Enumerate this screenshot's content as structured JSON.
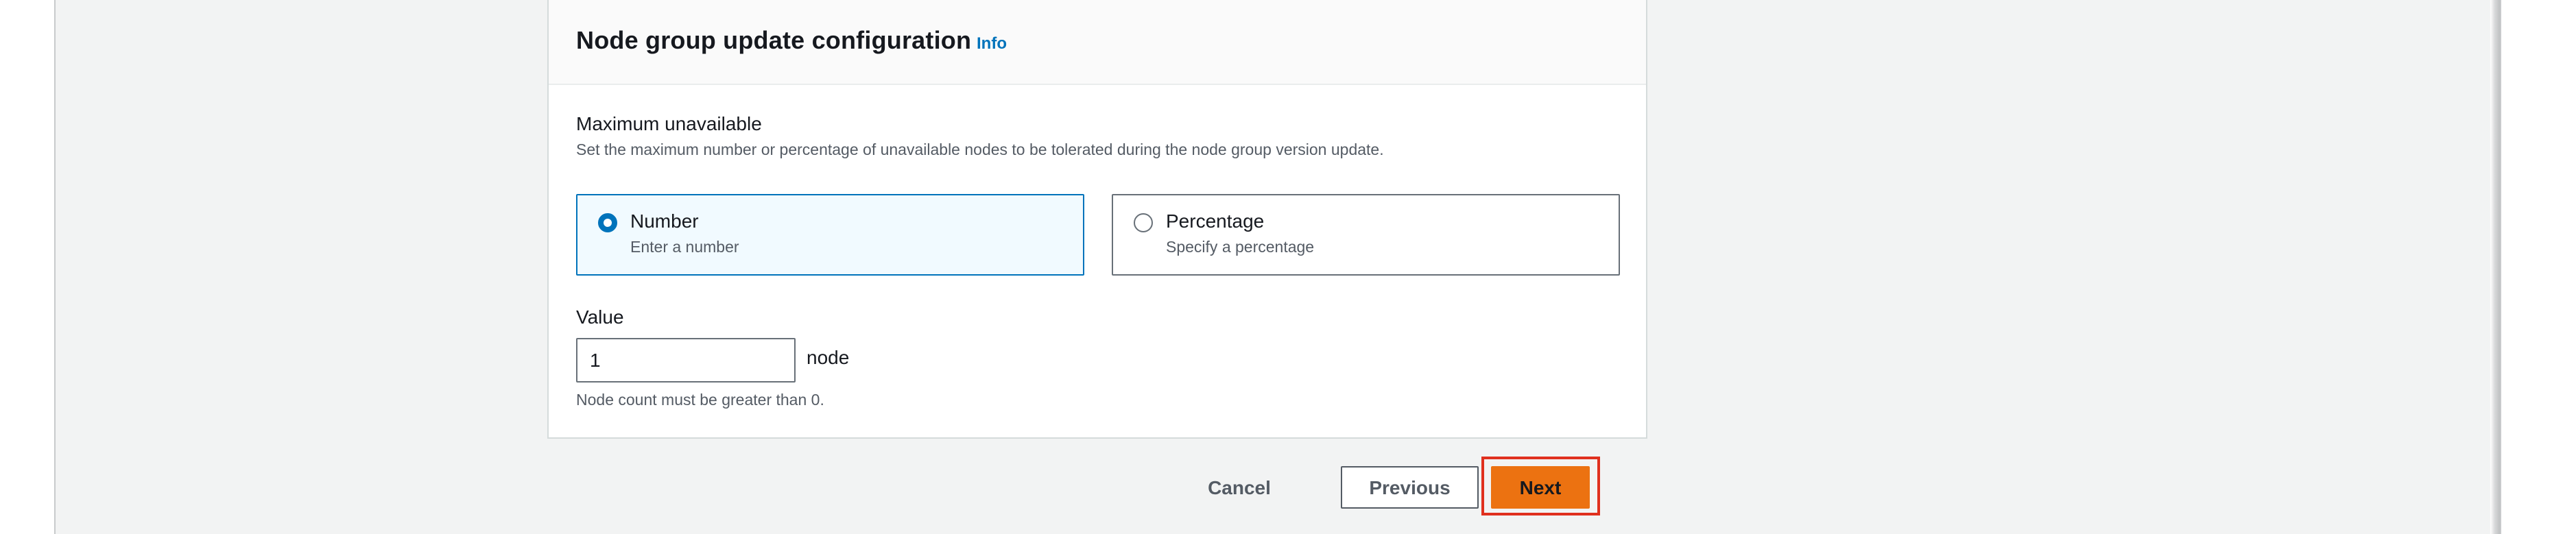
{
  "panel": {
    "title": "Node group update configuration",
    "info_link": "Info"
  },
  "max_unavailable": {
    "label": "Maximum unavailable",
    "description": "Set the maximum number or percentage of unavailable nodes to be tolerated during the node group version update.",
    "selected": "number",
    "options": [
      {
        "label": "Number",
        "description": "Enter a number"
      },
      {
        "label": "Percentage",
        "description": "Specify a percentage"
      }
    ]
  },
  "value_field": {
    "label": "Value",
    "value": "1",
    "unit": "node",
    "constraint": "Node count must be greater than 0."
  },
  "actions": {
    "cancel": "Cancel",
    "previous": "Previous",
    "next": "Next"
  },
  "colors": {
    "primary_button": "#ec7211",
    "link": "#0073bb",
    "selected_tile_bg": "#f1faff",
    "highlight": "#e0301e"
  }
}
